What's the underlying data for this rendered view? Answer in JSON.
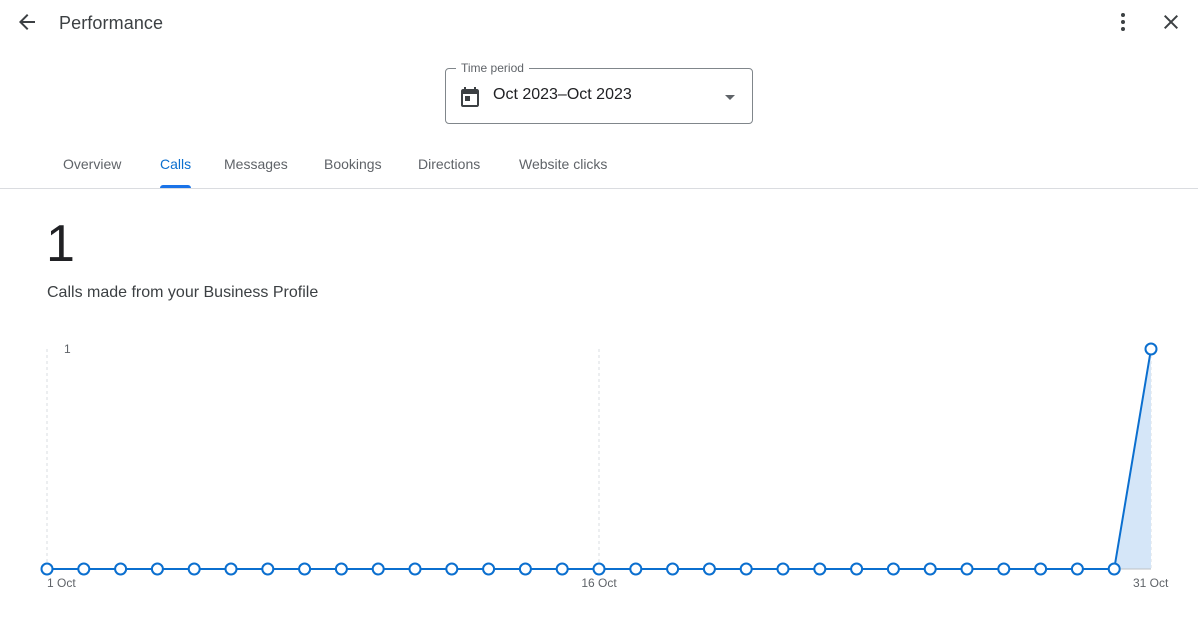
{
  "header": {
    "title": "Performance",
    "back_icon": "arrow-back-icon",
    "more_icon": "more-vert-icon",
    "close_icon": "close-icon"
  },
  "period": {
    "label": "Time period",
    "value": "Oct 2023–Oct 2023",
    "icon": "calendar-icon"
  },
  "tabs": [
    {
      "label": "Overview",
      "active": false
    },
    {
      "label": "Calls",
      "active": true
    },
    {
      "label": "Messages",
      "active": false
    },
    {
      "label": "Bookings",
      "active": false
    },
    {
      "label": "Directions",
      "active": false
    },
    {
      "label": "Website clicks",
      "active": false
    }
  ],
  "metric": {
    "value": "1",
    "label": "Calls made from your Business Profile"
  },
  "colors": {
    "accent": "#1a73e8",
    "line": "#0b6fcf",
    "area": "#d5e6f8"
  },
  "chart_data": {
    "type": "area",
    "x": [
      1,
      2,
      3,
      4,
      5,
      6,
      7,
      8,
      9,
      10,
      11,
      12,
      13,
      14,
      15,
      16,
      17,
      18,
      19,
      20,
      21,
      22,
      23,
      24,
      25,
      26,
      27,
      28,
      29,
      30,
      31
    ],
    "series": [
      {
        "values": [
          0,
          0,
          0,
          0,
          0,
          0,
          0,
          0,
          0,
          0,
          0,
          0,
          0,
          0,
          0,
          0,
          0,
          0,
          0,
          0,
          0,
          0,
          0,
          0,
          0,
          0,
          0,
          0,
          0,
          0,
          1
        ]
      }
    ],
    "x_tick_labels": [
      {
        "day": 1,
        "label": "1 Oct"
      },
      {
        "day": 16,
        "label": "16 Oct"
      },
      {
        "day": 31,
        "label": "31 Oct"
      }
    ],
    "y_tick_labels": [
      {
        "value": 1,
        "label": "1"
      }
    ],
    "ylim": [
      0,
      1
    ],
    "xlim": [
      1,
      31
    ],
    "grid": "vertical-dashed"
  }
}
